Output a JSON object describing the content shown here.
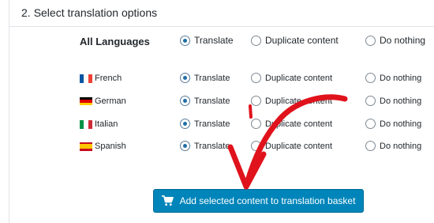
{
  "section": {
    "number": "2.",
    "title": "Select translation options"
  },
  "options": {
    "translate": "Translate",
    "duplicate": "Duplicate content",
    "nothing": "Do nothing"
  },
  "all_languages": {
    "label": "All Languages",
    "selected": "translate"
  },
  "languages": [
    {
      "name": "French",
      "flag": "fr-flag-icon",
      "selected": "translate"
    },
    {
      "name": "German",
      "flag": "de-flag-icon",
      "selected": "translate"
    },
    {
      "name": "Italian",
      "flag": "it-flag-icon",
      "selected": "translate"
    },
    {
      "name": "Spanish",
      "flag": "es-flag-icon",
      "selected": "translate"
    }
  ],
  "button": {
    "label": "Add selected content to translation basket",
    "icon": "cart-icon"
  },
  "colors": {
    "button_bg": "#0085ba",
    "annotation_arrow": "#e0131c",
    "radio_checked": "#1e6ea7"
  }
}
